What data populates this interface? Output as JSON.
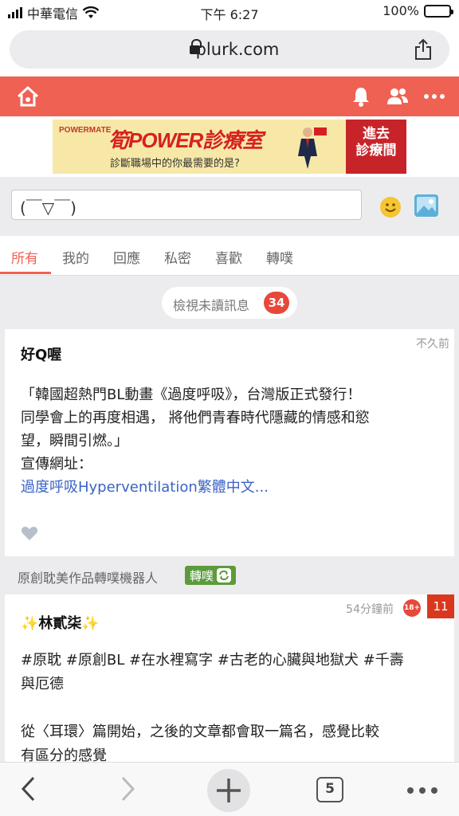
{
  "status_bar": {
    "carrier": "中華電信",
    "time": "下午 6:27",
    "battery": "100%"
  },
  "browser": {
    "url": "plurk.com",
    "tab_count": "5"
  },
  "ad": {
    "brand": "POWERMATE",
    "title": "筍POWER診療室",
    "subtitle": "診斷職場中的你最需要的是?",
    "cta_line1": "進去",
    "cta_line2": "診療間"
  },
  "compose": {
    "placeholder": "(￣▽￣)"
  },
  "tabs": [
    {
      "label": "所有"
    },
    {
      "label": "我的"
    },
    {
      "label": "回應"
    },
    {
      "label": "私密"
    },
    {
      "label": "喜歡"
    },
    {
      "label": "轉噗"
    }
  ],
  "unread": {
    "label": "檢視未讀訊息",
    "count": "34"
  },
  "posts": [
    {
      "author": "好Q喔",
      "time": "不久前",
      "lines": [
        "「韓國超熱門BL動畫《過度呼吸》，台灣版正式發行！",
        "同學會上的再度相遇， 將他們青春時代隱藏的情感和慾",
        "望，瞬間引燃。」",
        "宣傳網址："
      ],
      "link": "過度呼吸Hyperventilation繁體中文..."
    },
    {
      "repost_by": "原創耽美作品轉噗機器人",
      "repost_badge": "轉噗",
      "author": "✨林貳柒✨",
      "time": "54分鐘前",
      "rating": "18+",
      "response_count": "11",
      "lines": [
        "#原耽 #原創BL #在水裡寫字 #古老的心臟與地獄犬 #千壽",
        "與厄德",
        "",
        "從〈耳環〉篇開始，之後的文章都會取一篇名，感覺比較",
        "有區分的感覺"
      ]
    }
  ],
  "colors": {
    "accent": "#ef6153",
    "link": "#3b63c4",
    "repost": "#5b9b3b"
  }
}
